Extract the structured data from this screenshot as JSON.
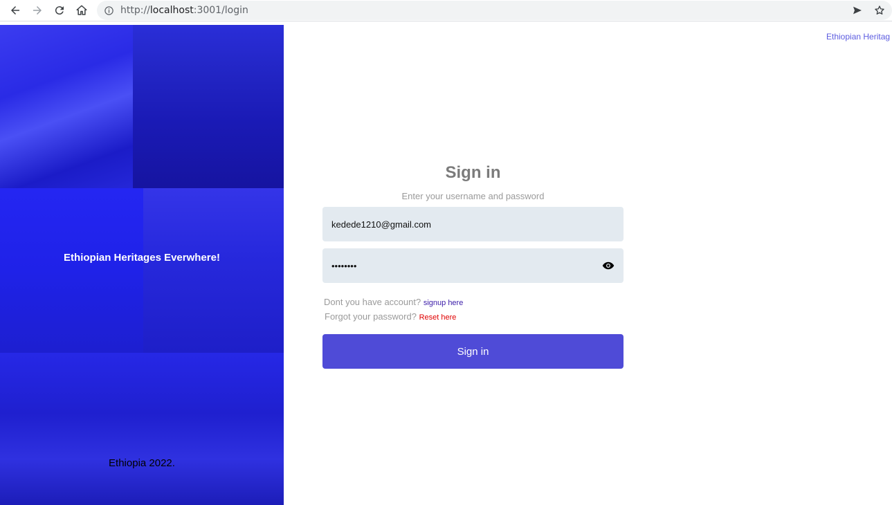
{
  "browser": {
    "url_scheme": "http://",
    "url_host": "localhost",
    "url_path": ":3001/login"
  },
  "left_panel": {
    "hero_text": "Ethiopian Heritages Everwhere!",
    "footer_text": "Ethiopia 2022."
  },
  "header": {
    "brand_link": "Ethiopian Heritag"
  },
  "form": {
    "title": "Sign in",
    "subtitle": "Enter your username and password",
    "email_value": "kedede1210@gmail.com",
    "password_value": "••••••••",
    "signup_prompt": "Dont you have account?",
    "signup_link": "signup here",
    "reset_prompt": "Forgot your password?",
    "reset_link": "Reset here",
    "submit_label": "Sign in"
  },
  "colors": {
    "primary": "#4f4bd7",
    "overlay": "#1d1ee0",
    "input_bg": "#e3eaf0",
    "signup_link": "#3a1ba8",
    "reset_link": "#e00000"
  },
  "icons": [
    "back-icon",
    "forward-icon",
    "reload-icon",
    "home-icon",
    "info-icon",
    "send-icon",
    "star-icon",
    "eye-icon"
  ]
}
